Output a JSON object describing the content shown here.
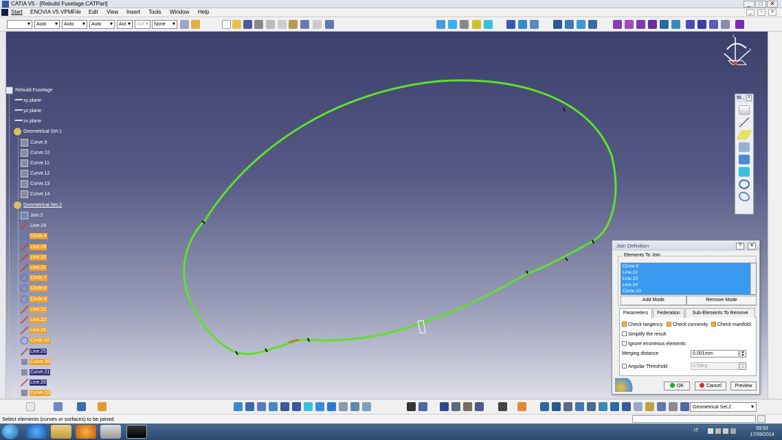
{
  "window": {
    "title": "CATIA V5 - [Rebuild Fuselage.CATPart]",
    "minimize": "_",
    "maximize": "□",
    "close": "✕"
  },
  "menu": {
    "items": [
      "Start",
      "ENOVIA V5 VPM",
      "File",
      "Edit",
      "View",
      "Insert",
      "Tools",
      "Window",
      "Help"
    ]
  },
  "toolbar": {
    "combos": [
      "",
      "Auto",
      "Auto",
      "Auto",
      "Aut",
      "Aut",
      "None"
    ]
  },
  "tree": {
    "root": "Rebuild Fuselage",
    "planes": [
      "xy plane",
      "yz plane",
      "zx plane"
    ],
    "set1": "Geometrical Set.1",
    "set1_items": [
      "Curve.9",
      "Curve.10",
      "Curve.11",
      "Curve.12",
      "Curve.13",
      "Curve.14"
    ],
    "set2": "Geometrical Set.2",
    "set2_items": [
      {
        "label": "Join.2",
        "style": "plain",
        "type": "join"
      },
      {
        "label": "Line.18",
        "style": "plain",
        "type": "line"
      },
      {
        "label": "Circle.4",
        "style": "hl",
        "type": "circle"
      },
      {
        "label": "Line.19",
        "style": "hl",
        "type": "line"
      },
      {
        "label": "Line.20",
        "style": "hl",
        "type": "line"
      },
      {
        "label": "Line.21",
        "style": "hl",
        "type": "line"
      },
      {
        "label": "Circle.7",
        "style": "hl",
        "type": "circle"
      },
      {
        "label": "Circle.8",
        "style": "hl",
        "type": "circle"
      },
      {
        "label": "Circle.9",
        "style": "hl",
        "type": "circle"
      },
      {
        "label": "Line.22",
        "style": "hl",
        "type": "line"
      },
      {
        "label": "Line.23",
        "style": "hl",
        "type": "line"
      },
      {
        "label": "Line.24",
        "style": "hl",
        "type": "line"
      },
      {
        "label": "Circle.10",
        "style": "hl",
        "type": "circle"
      },
      {
        "label": "Line.25",
        "style": "sel",
        "type": "line"
      },
      {
        "label": "Curve.20",
        "style": "hl",
        "type": "curve"
      },
      {
        "label": "Curve.21",
        "style": "sel",
        "type": "curve"
      },
      {
        "label": "Line.26",
        "style": "sel",
        "type": "line"
      },
      {
        "label": "Curve.22",
        "style": "hl",
        "type": "curve"
      }
    ]
  },
  "side_panel": {
    "title": "W..."
  },
  "dialog": {
    "title": "Join Definition",
    "help_btn": "?",
    "close_btn": "✕",
    "group_label": "Elements To Join",
    "elements": [
      "Circle.9",
      "Line.22",
      "Line.23",
      "Line.24",
      "Circle.10"
    ],
    "add_mode": "Add Mode",
    "remove_mode": "Remove Mode",
    "tabs": [
      "Parameters",
      "Federation",
      "Sub-Elements To Remove"
    ],
    "check_tangency": "Check tangency",
    "check_connexity": "Check connexity",
    "check_manifold": "Check manifold",
    "simplify": "Simplify the result",
    "ignore": "Ignore erroneous elements",
    "merging_label": "Merging distance",
    "merging_value": "0,001mm",
    "angular_label": "Angular Threshold",
    "angular_value": "0,5deg",
    "ok": "OK",
    "cancel": "Cancel",
    "preview": "Preview"
  },
  "bottom": {
    "combo": "Geometrical Set.2"
  },
  "status": {
    "message": "Select elements (curves or surfaces) to be joined"
  },
  "taskbar": {
    "lang": "IT",
    "time": "09:53",
    "date": "17/09/2014"
  },
  "colors": {
    "curve": "#5ee12a",
    "tree_highlight": "#f0a020",
    "tree_selected": "#30307a",
    "list_selection": "#3a9af0"
  }
}
